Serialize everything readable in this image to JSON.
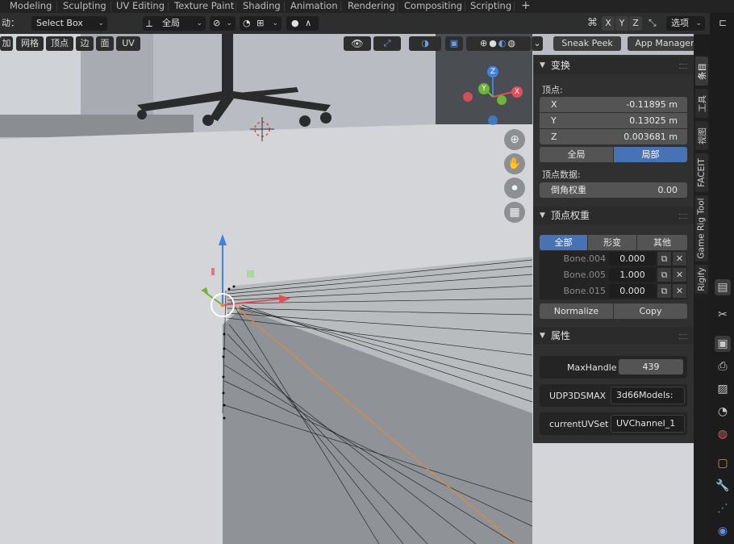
{
  "workspace_tabs": [
    "Modeling",
    "Sculpting",
    "UV Editing",
    "Texture Paint",
    "Shading",
    "Animation",
    "Rendering",
    "Compositing",
    "Scripting",
    "+"
  ],
  "header": {
    "mode_label": "动：",
    "select_tool": "Select Box",
    "transform_orientation": "全局",
    "axis_x": "X",
    "axis_y": "Y",
    "axis_z": "Z",
    "options_label": "选项"
  },
  "edit_menu": [
    "加",
    "网格",
    "顶点",
    "边",
    "面",
    "UV"
  ],
  "viewport_header": {
    "sneak_peek": "Sneak Peek",
    "app_manager": "App Manager"
  },
  "gizmo": {
    "z": "Z",
    "y": "Y",
    "x": "X"
  },
  "npanel": {
    "transform": {
      "title": "变换",
      "vertex_label": "顶点:",
      "x_label": "X",
      "x_value": "-0.11895 m",
      "y_label": "Y",
      "y_value": "0.13025 m",
      "z_label": "Z",
      "z_value": "0.003681 m",
      "space_global": "全局",
      "space_local": "局部",
      "vertex_data_label": "顶点数据:",
      "bevel_weight_label": "倒角权重",
      "bevel_weight_value": "0.00"
    },
    "vertex_weights": {
      "title": "顶点权重",
      "filters": [
        "全部",
        "形变",
        "其他"
      ],
      "rows": [
        {
          "bone": "Bone.004",
          "weight": "0.000"
        },
        {
          "bone": "Bone.005",
          "weight": "1.000"
        },
        {
          "bone": "Bone.015",
          "weight": "0.000"
        }
      ],
      "normalize": "Normalize",
      "copy": "Copy"
    },
    "properties": {
      "title": "属性",
      "maxhandle_label": "MaxHandle",
      "maxhandle_value": "439",
      "udp_label": "UDP3DSMAX",
      "udp_value": "3d66Models: ...",
      "uvset_label": "currentUVSet",
      "uvset_value": "UVChannel_1"
    }
  },
  "sidebar_tabs": [
    "条目",
    "工具",
    "视图",
    "FACEIT",
    "Game Rig Tool",
    "Rigify"
  ],
  "colors": {
    "accent_blue": "#4772b3",
    "axis_x": "#e0505a",
    "axis_y": "#6fb33a",
    "axis_z": "#3f82e0",
    "edge_orange": "#e08a3a"
  }
}
